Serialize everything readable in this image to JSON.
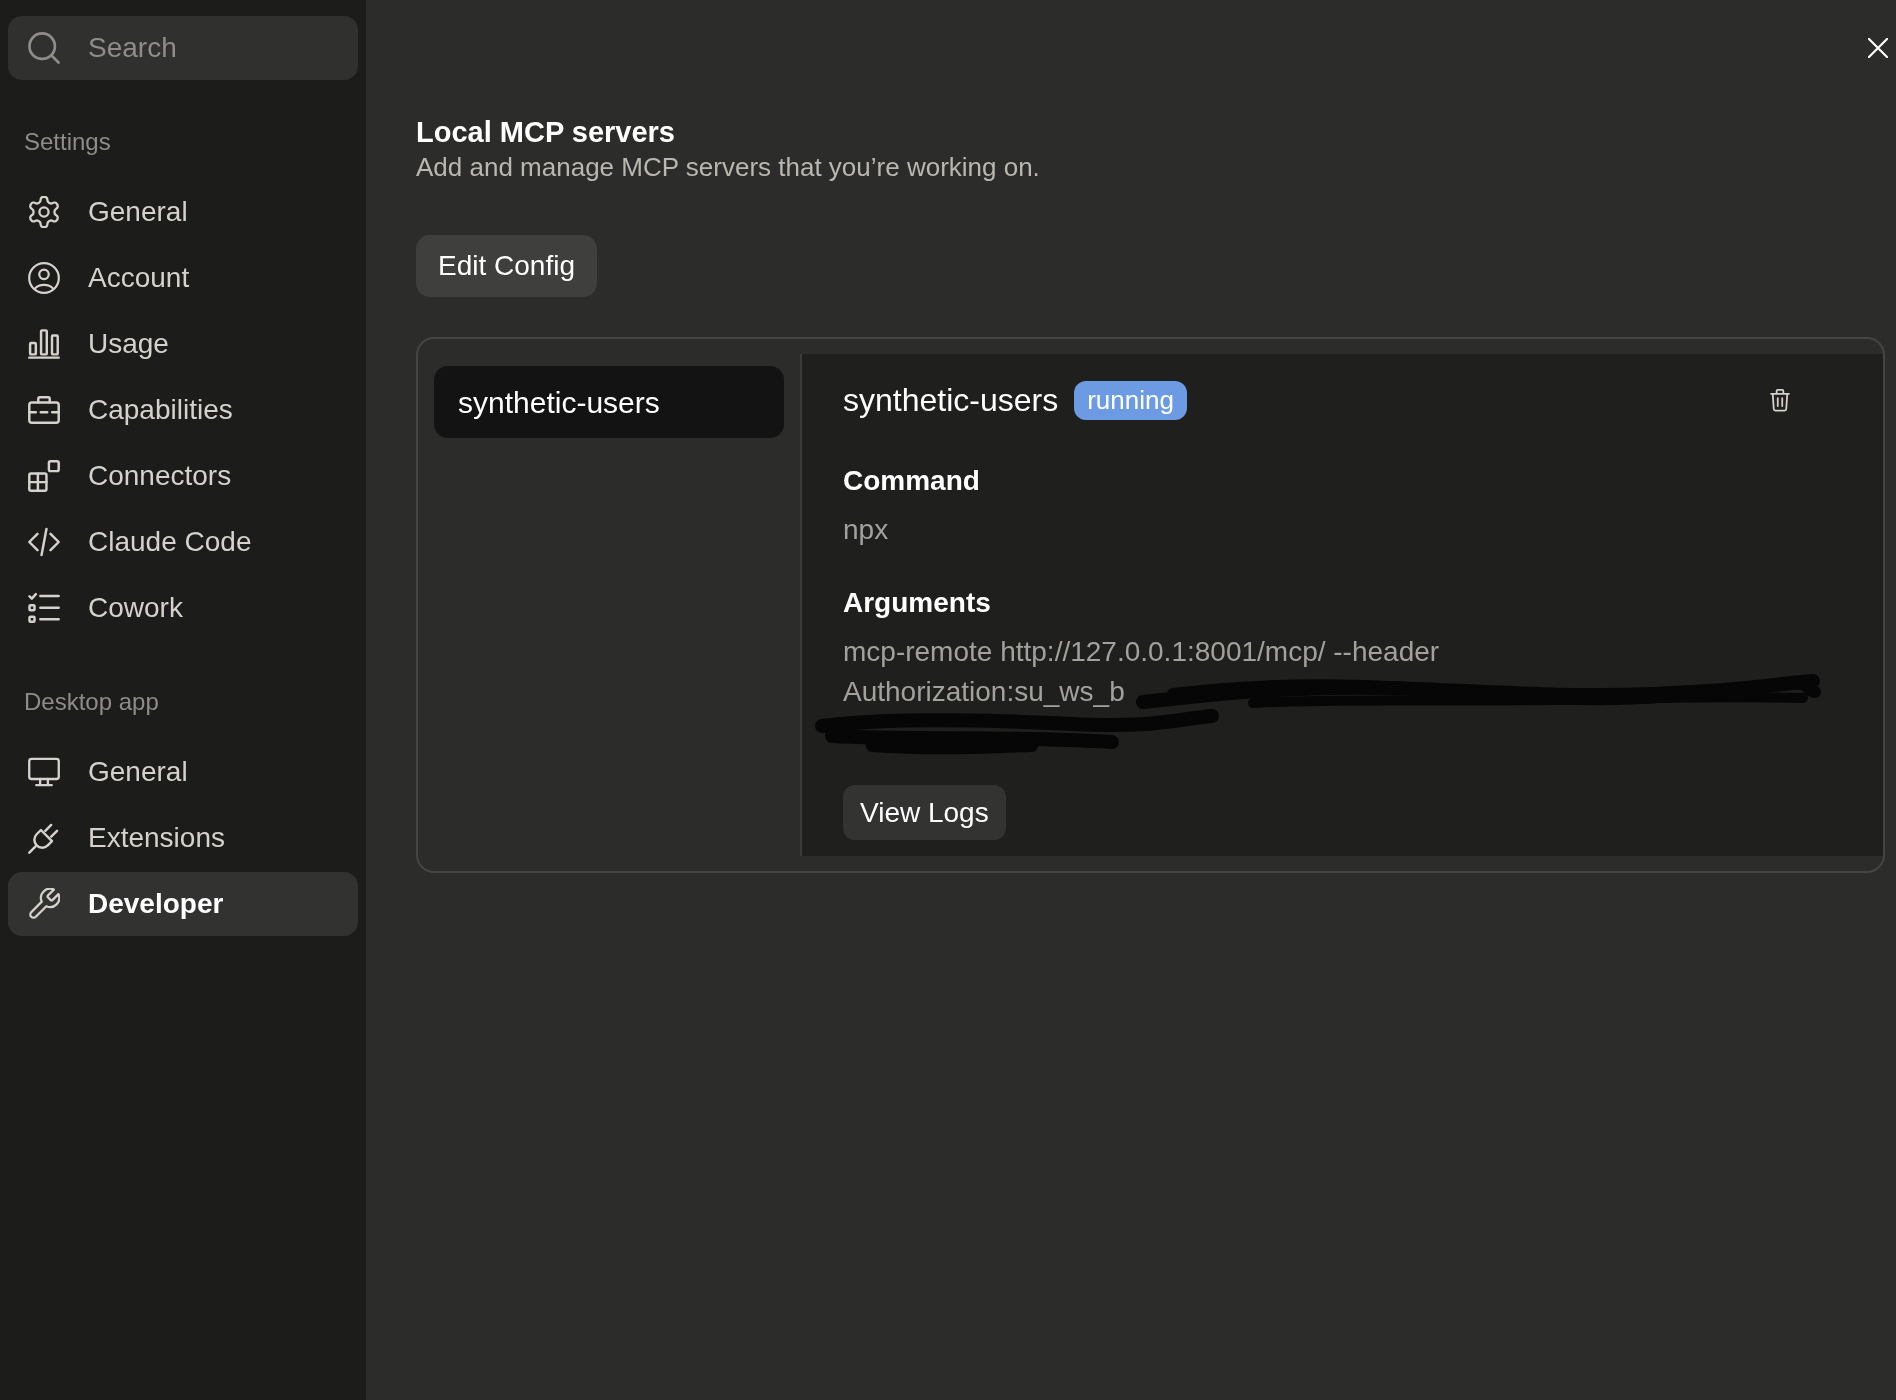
{
  "sidebar": {
    "search": {
      "placeholder": "Search"
    },
    "sections": [
      {
        "heading": "Settings",
        "items": [
          {
            "label": "General",
            "selected": false
          },
          {
            "label": "Account",
            "selected": false
          },
          {
            "label": "Usage",
            "selected": false
          },
          {
            "label": "Capabilities",
            "selected": false
          },
          {
            "label": "Connectors",
            "selected": false
          },
          {
            "label": "Claude Code",
            "selected": false
          },
          {
            "label": "Cowork",
            "selected": false
          }
        ]
      },
      {
        "heading": "Desktop app",
        "items": [
          {
            "label": "General",
            "selected": false
          },
          {
            "label": "Extensions",
            "selected": false
          },
          {
            "label": "Developer",
            "selected": true
          }
        ]
      }
    ]
  },
  "page": {
    "title": "Local MCP servers",
    "description": "Add and manage MCP servers that you’re working on.",
    "edit_config_button": "Edit Config"
  },
  "servers": {
    "list": [
      {
        "name": "synthetic-users",
        "selected": true
      }
    ],
    "detail": {
      "name": "synthetic-users",
      "status": "running",
      "fields": [
        {
          "label": "Command",
          "value_lines": [
            "npx"
          ],
          "redacted": false
        },
        {
          "label": "Arguments",
          "value_lines": [
            "mcp-remote http://127.0.0.1:8001/mcp/ --header",
            "Authorization:su_ws_b"
          ],
          "redacted": true
        }
      ],
      "view_logs_button": "View Logs"
    }
  }
}
